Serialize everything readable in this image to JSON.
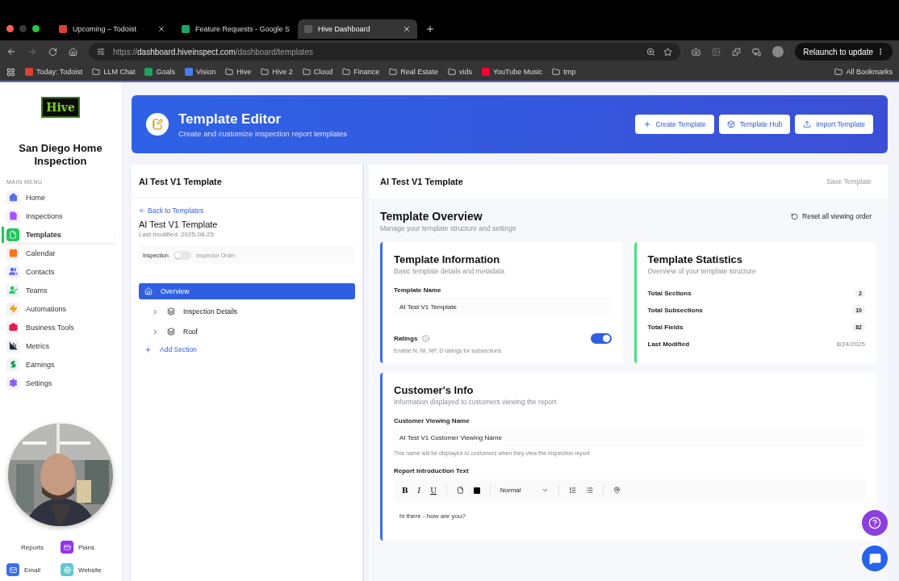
{
  "browser": {
    "tabs": [
      {
        "title": "Upcoming – Todoist",
        "selected": false,
        "color": "#db4035"
      },
      {
        "title": "Feature Requests - Google S",
        "selected": false,
        "color": "#1ea362"
      },
      {
        "title": "Hive Dashboard",
        "selected": true,
        "color": "#5a5a5a"
      }
    ],
    "url": {
      "scheme": "https://",
      "host": "dashboard.hiveinspect.com",
      "path": "/dashboard/templates"
    },
    "update_button": "Relaunch to update",
    "bookmarks": [
      {
        "label": "Today: Todoist",
        "kind": "app",
        "color": "#db4035"
      },
      {
        "label": "LLM Chat",
        "kind": "folder"
      },
      {
        "label": "Goals",
        "kind": "app",
        "color": "#1ea362"
      },
      {
        "label": "Vision",
        "kind": "app",
        "color": "#4a7cf0"
      },
      {
        "label": "Hive",
        "kind": "folder"
      },
      {
        "label": "Hive 2",
        "kind": "folder"
      },
      {
        "label": "Cloud",
        "kind": "folder"
      },
      {
        "label": "Finance",
        "kind": "folder"
      },
      {
        "label": "Real Estate",
        "kind": "folder"
      },
      {
        "label": "vids",
        "kind": "folder"
      },
      {
        "label": "YouTube Music",
        "kind": "app",
        "color": "#ff0033"
      },
      {
        "label": "tmp",
        "kind": "folder"
      }
    ],
    "all_bookmarks": "All Bookmarks"
  },
  "sidebar": {
    "logo": "Hive",
    "company": "San Diego Home Inspection",
    "menu_title": "MAIN MENU",
    "menu": [
      {
        "label": "Home",
        "selected": false,
        "color": "#5b6ee8"
      },
      {
        "label": "Inspections",
        "selected": false,
        "color": "#a855f7"
      },
      {
        "label": "Templates",
        "selected": true,
        "color": "#22c55e"
      },
      {
        "label": "Calendar",
        "selected": false,
        "color": "#f97316"
      },
      {
        "label": "Contacts",
        "selected": false,
        "color": "#6366f1"
      },
      {
        "label": "Teams",
        "selected": false,
        "color": "#22c55e"
      },
      {
        "label": "Automations",
        "selected": false,
        "color": "#f59e0b"
      },
      {
        "label": "Business Tools",
        "selected": false,
        "color": "#e11d48"
      },
      {
        "label": "Metrics",
        "selected": false,
        "color": "#1f2937"
      },
      {
        "label": "Earnings",
        "selected": false,
        "color": "#16a34a"
      },
      {
        "label": "Settings",
        "selected": false,
        "color": "#8b5cf6"
      }
    ],
    "quick_links": [
      {
        "label": "Reports"
      },
      {
        "label": "Plans",
        "color": "#9333ea"
      },
      {
        "label": "Email",
        "color": "#3b6fe8"
      },
      {
        "label": "Website",
        "color": "#5ec8d0"
      }
    ]
  },
  "header": {
    "title": "Template Editor",
    "subtitle": "Create and customize inspection report templates",
    "actions": [
      "Create Template",
      "Template Hub",
      "Import Template"
    ]
  },
  "structure_panel": {
    "title": "AI Test V1 Template",
    "back_link": "Back to Templates",
    "template_name": "AI Test V1 Template",
    "last_modified": "Last modified: 2025-08-25",
    "order_toggle": {
      "left_label": "Inspection",
      "right_label": "Inspector Order",
      "on": false
    },
    "tree": [
      {
        "label": "Overview",
        "kind": "overview",
        "selected": true
      },
      {
        "label": "Inspection Details",
        "kind": "section",
        "selected": false,
        "expanded": false
      },
      {
        "label": "Roof",
        "kind": "section",
        "selected": false,
        "expanded": false
      }
    ],
    "add_section": "Add Section"
  },
  "content": {
    "title": "AI Test V1 Template",
    "save_button": "Save Template",
    "overview": {
      "title": "Template Overview",
      "subtitle": "Manage your template structure and settings",
      "reset_button": "Reset all viewing order"
    },
    "info_card": {
      "title": "Template Information",
      "subtitle": "Basic template details and metadata",
      "name_label": "Template Name",
      "name_value": "AI Test V1 Template",
      "ratings_label": "Ratings",
      "ratings_on": true,
      "ratings_hint": "Enable N, NI, NP, D ratings for subsections"
    },
    "stats_card": {
      "title": "Template Statistics",
      "subtitle": "Overview of your template structure",
      "rows": [
        {
          "label": "Total Sections",
          "value": "2",
          "kind": "count"
        },
        {
          "label": "Total Subsections",
          "value": "10",
          "kind": "count"
        },
        {
          "label": "Total Fields",
          "value": "82",
          "kind": "count"
        },
        {
          "label": "Last Modified",
          "value": "8/24/2025",
          "kind": "date"
        }
      ]
    },
    "customer_card": {
      "title": "Customer's Info",
      "subtitle": "Information displayed to customers viewing the report",
      "viewing_name_label": "Customer Viewing Name",
      "viewing_name_value": "AI Test V1 Customer Viewing Name",
      "viewing_name_hint": "This name will be displayed to customers when they view the inspection report",
      "intro_label": "Report Introduction Text",
      "toolbar": {
        "format_buttons": [
          "B",
          "I",
          "U"
        ],
        "block_style": "Normal"
      },
      "intro_text": "hi there - how are you?"
    }
  }
}
